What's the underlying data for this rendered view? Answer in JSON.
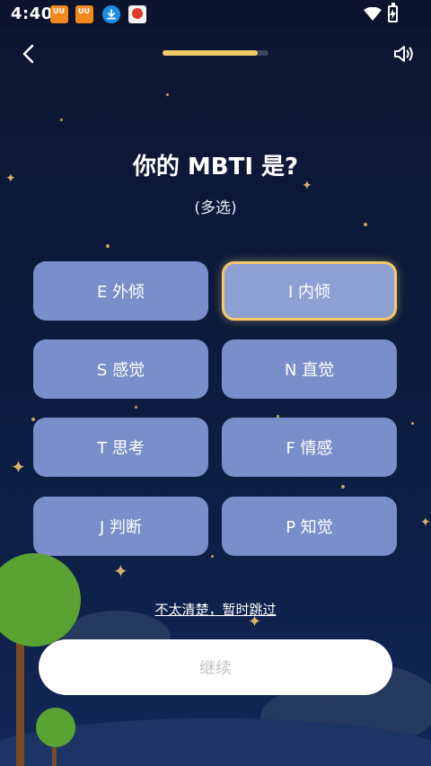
{
  "status_bar": {
    "time": "4:40",
    "notifications": [
      "uu-app-icon",
      "uu-app-icon",
      "download-icon",
      "app-icon"
    ],
    "uu_badge": "UU"
  },
  "nav": {
    "back_icon": "chevron-left-icon",
    "sound_icon": "speaker-icon",
    "progress_fraction": 0.9
  },
  "question": {
    "title": "你的 MBTI 是?",
    "subtitle": "(多选)"
  },
  "options": [
    {
      "label": "E 外倾",
      "selected": false
    },
    {
      "label": "I 内倾",
      "selected": true
    },
    {
      "label": "S 感觉",
      "selected": false
    },
    {
      "label": "N 直觉",
      "selected": false
    },
    {
      "label": "T 思考",
      "selected": false
    },
    {
      "label": "F 情感",
      "selected": false
    },
    {
      "label": "J 判断",
      "selected": false
    },
    {
      "label": "P 知觉",
      "selected": false
    }
  ],
  "skip_label": "不太清楚，暂时跳过",
  "continue_label": "继续",
  "colors": {
    "background": "#0c1a3b",
    "option": "#7a8ec9",
    "selected_border": "#f3c96c",
    "progress": "#f4c96a"
  }
}
